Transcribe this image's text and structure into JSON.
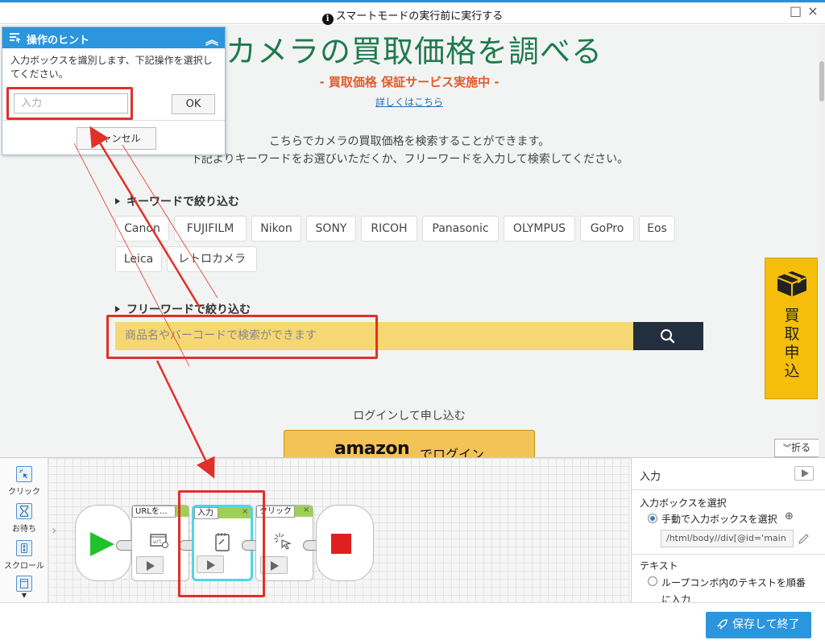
{
  "window": {
    "notice": "スマートモードの実行前に実行する",
    "maximize_glyph": "□",
    "close_glyph": "×"
  },
  "page": {
    "title": "カメラの買取価格を調べる",
    "subtitle": "- 買取価格 保証サービス実施中 -",
    "details_link": "詳しくはこちら",
    "desc_line1": "こちらでカメラの買取価格を検索することができます。",
    "desc_line2": "下記よりキーワードをお選びいただくか、フリーワードを入力して検索してください。",
    "keyword_heading": "キーワードで絞り込む",
    "keywords": [
      "Canon",
      "FUJIFILM",
      "Nikon",
      "SONY",
      "RICOH",
      "Panasonic",
      "OLYMPUS",
      "GoPro",
      "Eos",
      "Leica",
      "レトロカメラ"
    ],
    "freeword_heading": "フリーワードで絞り込む",
    "search_placeholder": "商品名やバーコードで検索ができます",
    "buy_panel_text": "買取申込",
    "login_text": "ログインして申し込む",
    "amazon_logo": "amazon",
    "amazon_suffix": "でログイン",
    "fold_label": "折る"
  },
  "hint": {
    "title": "操作のヒント",
    "message": "入力ボックスを識別します、下記操作を選択してください。",
    "input_placeholder": "入力",
    "ok_label": "OK",
    "cancel_label": "キャンセル"
  },
  "toolbox": {
    "items": [
      {
        "label": "クリック",
        "icon": "click-tool-icon"
      },
      {
        "label": "お待ち",
        "icon": "hourglass-icon"
      },
      {
        "label": "スクロール",
        "icon": "scroll-icon"
      },
      {
        "label": "",
        "icon": "more-tools-icon"
      }
    ]
  },
  "flow": {
    "nodes": [
      {
        "label": "URLを...",
        "icon": "url-icon"
      },
      {
        "label": "入力",
        "icon": "notepad-icon"
      },
      {
        "label": "クリック",
        "icon": "click-icon"
      }
    ]
  },
  "props": {
    "title": "入力",
    "select_box_label": "入力ボックスを選択",
    "manual_select_label": "手動で入力ボックスを選択",
    "xpath_value": "/html/body//div[@id='main",
    "text_label": "テキスト",
    "loop_option_label": "ループコンボ内のテキストを順番に入力"
  },
  "footer": {
    "save_label": "保存して終了"
  },
  "colors": {
    "accent_blue": "#2b95de",
    "title_green": "#1f7a4e",
    "subtitle_orange": "#e05b2b",
    "search_yellow": "#f5d774",
    "panel_yellow": "#f5be0b",
    "annotation_red": "#e0302a"
  }
}
